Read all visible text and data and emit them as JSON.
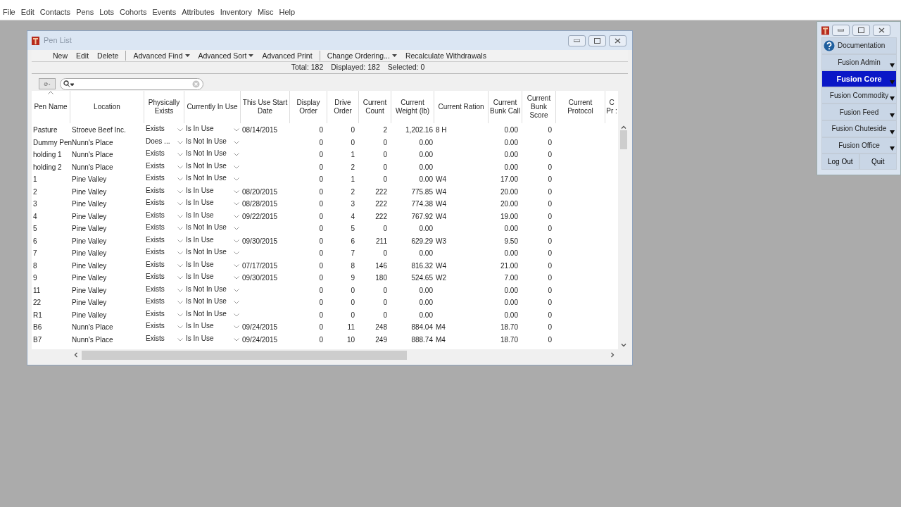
{
  "menu": [
    "File",
    "Edit",
    "Contacts",
    "Pens",
    "Lots",
    "Cohorts",
    "Events",
    "Attributes",
    "Inventory",
    "Misc",
    "Help"
  ],
  "window": {
    "title": "Pen List"
  },
  "toolbar": [
    {
      "kind": "button",
      "label": "New"
    },
    {
      "kind": "button",
      "label": "Edit"
    },
    {
      "kind": "button",
      "label": "Delete"
    },
    {
      "kind": "separator"
    },
    {
      "kind": "dropdown",
      "label": "Advanced Find"
    },
    {
      "kind": "dropdown",
      "label": "Advanced Sort"
    },
    {
      "kind": "button",
      "label": "Advanced Print"
    },
    {
      "kind": "separator"
    },
    {
      "kind": "dropdown",
      "label": "Change Ordering..."
    },
    {
      "kind": "button",
      "label": "Recalculate Withdrawals"
    }
  ],
  "status": [
    "Total: 182",
    "Displayed: 182",
    "Selected: 0"
  ],
  "columns": [
    {
      "label": "Pen Name",
      "kind": "text",
      "sorted": true
    },
    {
      "label": "Location",
      "kind": "text",
      "sorted": false
    },
    {
      "label": "Physically Exists",
      "kind": "dropdown",
      "sorted": false
    },
    {
      "label": "Currently In Use",
      "kind": "dropdown",
      "sorted": false
    },
    {
      "label": "This Use Start Date",
      "kind": "text",
      "sorted": false
    },
    {
      "label": "Display Order",
      "kind": "number",
      "sorted": false
    },
    {
      "label": "Drive Order",
      "kind": "number",
      "sorted": false
    },
    {
      "label": "Current Count",
      "kind": "number",
      "sorted": false
    },
    {
      "label": "Current Weight (lb)",
      "kind": "number",
      "sorted": false
    },
    {
      "label": "Current Ration",
      "kind": "text",
      "sorted": false
    },
    {
      "label": "Current Bunk Call",
      "kind": "number",
      "sorted": false
    },
    {
      "label": "Current Bunk Score",
      "kind": "number",
      "sorted": false
    },
    {
      "label": "Current Protocol",
      "sorted": false
    },
    {
      "label": "C Pr :",
      "sorted": false
    }
  ],
  "rows": [
    [
      "Pasture",
      "Stroeve Beef Inc.",
      "Exists",
      "Is In Use",
      "08/14/2015",
      "0",
      "0",
      "2",
      "1,202.16",
      "8 H",
      "0.00",
      "0"
    ],
    [
      "Dummy Pen",
      "Nunn's Place",
      "Does ...",
      "Is Not In Use",
      "",
      "0",
      "0",
      "0",
      "0.00",
      "",
      "0.00",
      "0"
    ],
    [
      "holding 1",
      "Nunn's Place",
      "Exists",
      "Is Not In Use",
      "",
      "0",
      "1",
      "0",
      "0.00",
      "",
      "0.00",
      "0"
    ],
    [
      "holding 2",
      "Nunn's Place",
      "Exists",
      "Is Not In Use",
      "",
      "0",
      "2",
      "0",
      "0.00",
      "",
      "0.00",
      "0"
    ],
    [
      "1",
      "Pine Valley",
      "Exists",
      "Is Not In Use",
      "",
      "0",
      "1",
      "0",
      "0.00",
      "W4",
      "17.00",
      "0"
    ],
    [
      "2",
      "Pine Valley",
      "Exists",
      "Is In Use",
      "08/20/2015",
      "0",
      "2",
      "222",
      "775.85",
      "W4",
      "20.00",
      "0"
    ],
    [
      "3",
      "Pine Valley",
      "Exists",
      "Is In Use",
      "08/28/2015",
      "0",
      "3",
      "222",
      "774.38",
      "W4",
      "20.00",
      "0"
    ],
    [
      "4",
      "Pine Valley",
      "Exists",
      "Is In Use",
      "09/22/2015",
      "0",
      "4",
      "222",
      "767.92",
      "W4",
      "19.00",
      "0"
    ],
    [
      "5",
      "Pine Valley",
      "Exists",
      "Is Not In Use",
      "",
      "0",
      "5",
      "0",
      "0.00",
      "",
      "0.00",
      "0"
    ],
    [
      "6",
      "Pine Valley",
      "Exists",
      "Is In Use",
      "09/30/2015",
      "0",
      "6",
      "211",
      "629.29",
      "W3",
      "9.50",
      "0"
    ],
    [
      "7",
      "Pine Valley",
      "Exists",
      "Is Not In Use",
      "",
      "0",
      "7",
      "0",
      "0.00",
      "",
      "0.00",
      "0"
    ],
    [
      "8",
      "Pine Valley",
      "Exists",
      "Is In Use",
      "07/17/2015",
      "0",
      "8",
      "146",
      "816.32",
      "W4",
      "21.00",
      "0"
    ],
    [
      "9",
      "Pine Valley",
      "Exists",
      "Is In Use",
      "09/30/2015",
      "0",
      "9",
      "180",
      "524.65",
      "W2",
      "7.00",
      "0"
    ],
    [
      "11",
      "Pine Valley",
      "Exists",
      "Is Not In Use",
      "",
      "0",
      "0",
      "0",
      "0.00",
      "",
      "0.00",
      "0"
    ],
    [
      "22",
      "Pine Valley",
      "Exists",
      "Is Not In Use",
      "",
      "0",
      "0",
      "0",
      "0.00",
      "",
      "0.00",
      "0"
    ],
    [
      "R1",
      "Pine Valley",
      "Exists",
      "Is Not In Use",
      "",
      "0",
      "0",
      "0",
      "0.00",
      "",
      "0.00",
      "0"
    ],
    [
      "B6",
      "Nunn's Place",
      "Exists",
      "Is In Use",
      "09/24/2015",
      "0",
      "11",
      "248",
      "884.04",
      "M4",
      "18.70",
      "0"
    ],
    [
      "B7",
      "Nunn's Place",
      "Exists",
      "Is In Use",
      "09/24/2015",
      "0",
      "10",
      "249",
      "888.74",
      "M4",
      "18.70",
      "0"
    ]
  ],
  "launcher": {
    "items": [
      {
        "kind": "help",
        "label": "Documentation",
        "selected": false
      },
      {
        "kind": "module",
        "label": "Fusion Admin",
        "selected": false
      },
      {
        "kind": "module",
        "label": "Fusion Core",
        "selected": true
      },
      {
        "kind": "module",
        "label": "Fusion Commodity",
        "selected": false
      },
      {
        "kind": "module",
        "label": "Fusion Feed",
        "selected": false
      },
      {
        "kind": "module",
        "label": "Fusion Chuteside",
        "selected": false
      },
      {
        "kind": "module",
        "label": "Fusion Office",
        "selected": false
      }
    ],
    "buttons": [
      "Log Out",
      "Quit"
    ]
  }
}
